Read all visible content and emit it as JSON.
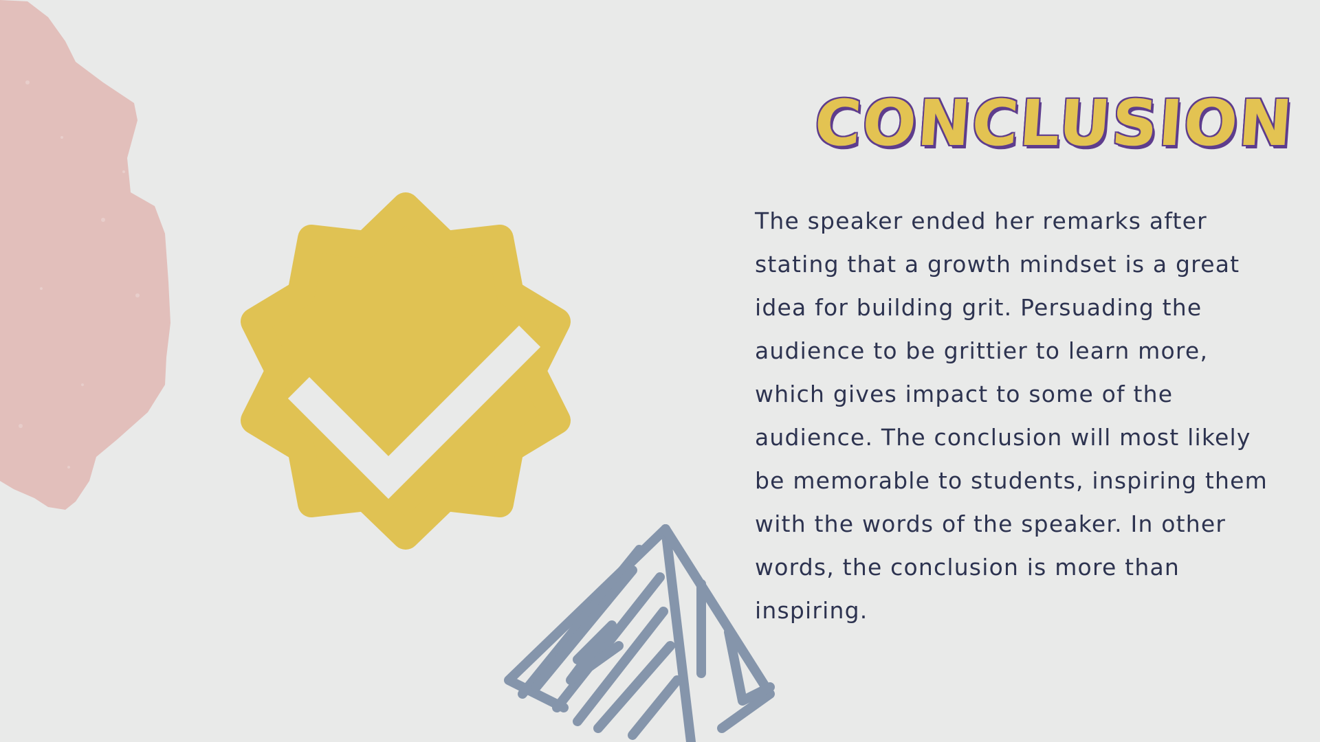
{
  "slide": {
    "title": "CONCLUSION",
    "body": "The speaker ended her remarks after stating that a growth mindset is a great idea for building grit. Persuading the audience to be grittier to learn more, which gives impact to some of the audience. The conclusion will most likely be memorable to students, inspiring them with the words of the speaker. In other words, the conclusion is more than inspiring."
  },
  "decor": {
    "badge_icon": "verified-check-badge-icon",
    "blob_icon": "pink-paint-blob-icon",
    "sketch_icon": "scribbled-triangle-sketch-icon"
  },
  "colors": {
    "background": "#e9eae9",
    "badge": "#e0c253",
    "check": "#e9eae9",
    "blob": "#e2bfbb",
    "sketch": "#8595ab",
    "title_fill": "#e3c352",
    "title_outline": "#5e3d8d",
    "body_text": "#2d3350"
  }
}
